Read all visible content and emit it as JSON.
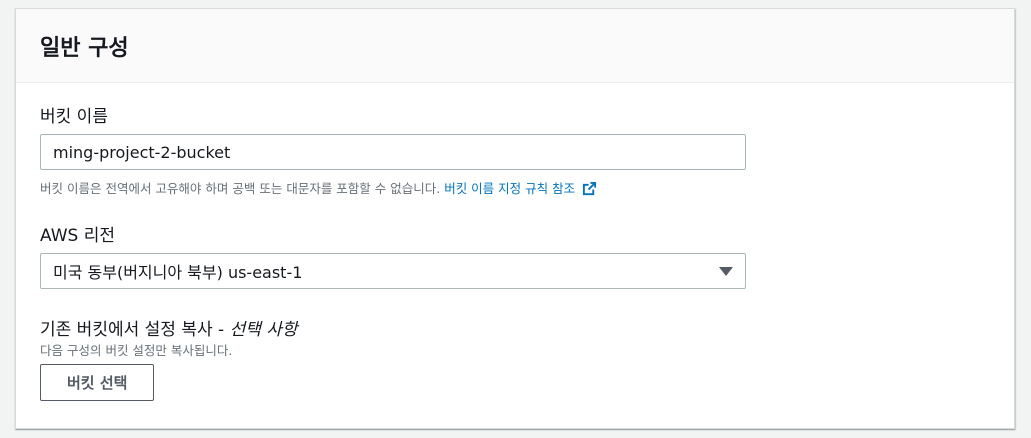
{
  "panel": {
    "title": "일반 구성"
  },
  "bucket_name": {
    "label": "버킷 이름",
    "value": "ming-project-2-bucket",
    "hint": "버킷 이름은 전역에서 고유해야 하며 공백 또는 대문자를 포함할 수 없습니다.",
    "link_text": "버킷 이름 지정 규칙 참조",
    "link_icon": "external-link-icon"
  },
  "region": {
    "label": "AWS 리전",
    "selected": "미국 동부(버지니아 북부) us-east-1",
    "dropdown_icon": "caret-down-icon"
  },
  "copy_settings": {
    "label": "기존 버킷에서 설정 복사 - ",
    "optional": "선택 사항",
    "description": "다음 구성의 버킷 설정만 복사됩니다.",
    "button_label": "버킷 선택"
  },
  "colors": {
    "link": "#0073bb",
    "border": "#aab7b8",
    "header_bg": "#fafafa",
    "page_bg": "#f2f3f3"
  }
}
